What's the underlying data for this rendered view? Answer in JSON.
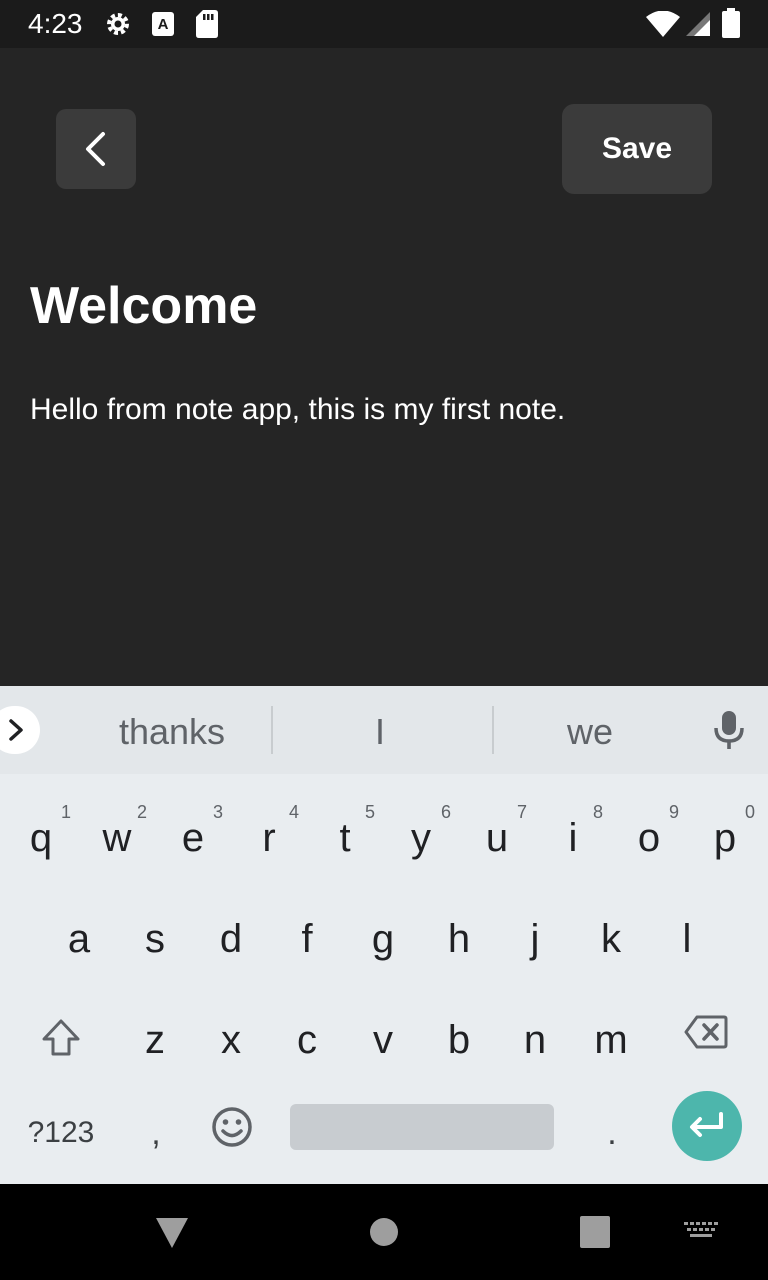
{
  "status_bar": {
    "time": "4:23",
    "icons": [
      "gear-icon",
      "a11y-a-icon",
      "sd-card-icon",
      "wifi-icon",
      "signal-icon",
      "battery-icon"
    ]
  },
  "editor": {
    "title": "Welcome",
    "body": "Hello from note app, this is my first note.",
    "save_label": "Save"
  },
  "keyboard": {
    "suggestions": [
      "thanks",
      "I",
      "we"
    ],
    "row1": [
      {
        "key": "q",
        "hint": "1"
      },
      {
        "key": "w",
        "hint": "2"
      },
      {
        "key": "e",
        "hint": "3"
      },
      {
        "key": "r",
        "hint": "4"
      },
      {
        "key": "t",
        "hint": "5"
      },
      {
        "key": "y",
        "hint": "6"
      },
      {
        "key": "u",
        "hint": "7"
      },
      {
        "key": "i",
        "hint": "8"
      },
      {
        "key": "o",
        "hint": "9"
      },
      {
        "key": "p",
        "hint": "0"
      }
    ],
    "row2": [
      "a",
      "s",
      "d",
      "f",
      "g",
      "h",
      "j",
      "k",
      "l"
    ],
    "row3": [
      "z",
      "x",
      "c",
      "v",
      "b",
      "n",
      "m"
    ],
    "symbols_label": "?123",
    "comma": ",",
    "period": "."
  },
  "colors": {
    "background": "#252525",
    "button": "#3b3b3b",
    "keyboard": "#e9edf0",
    "enter": "#4db6ac"
  }
}
